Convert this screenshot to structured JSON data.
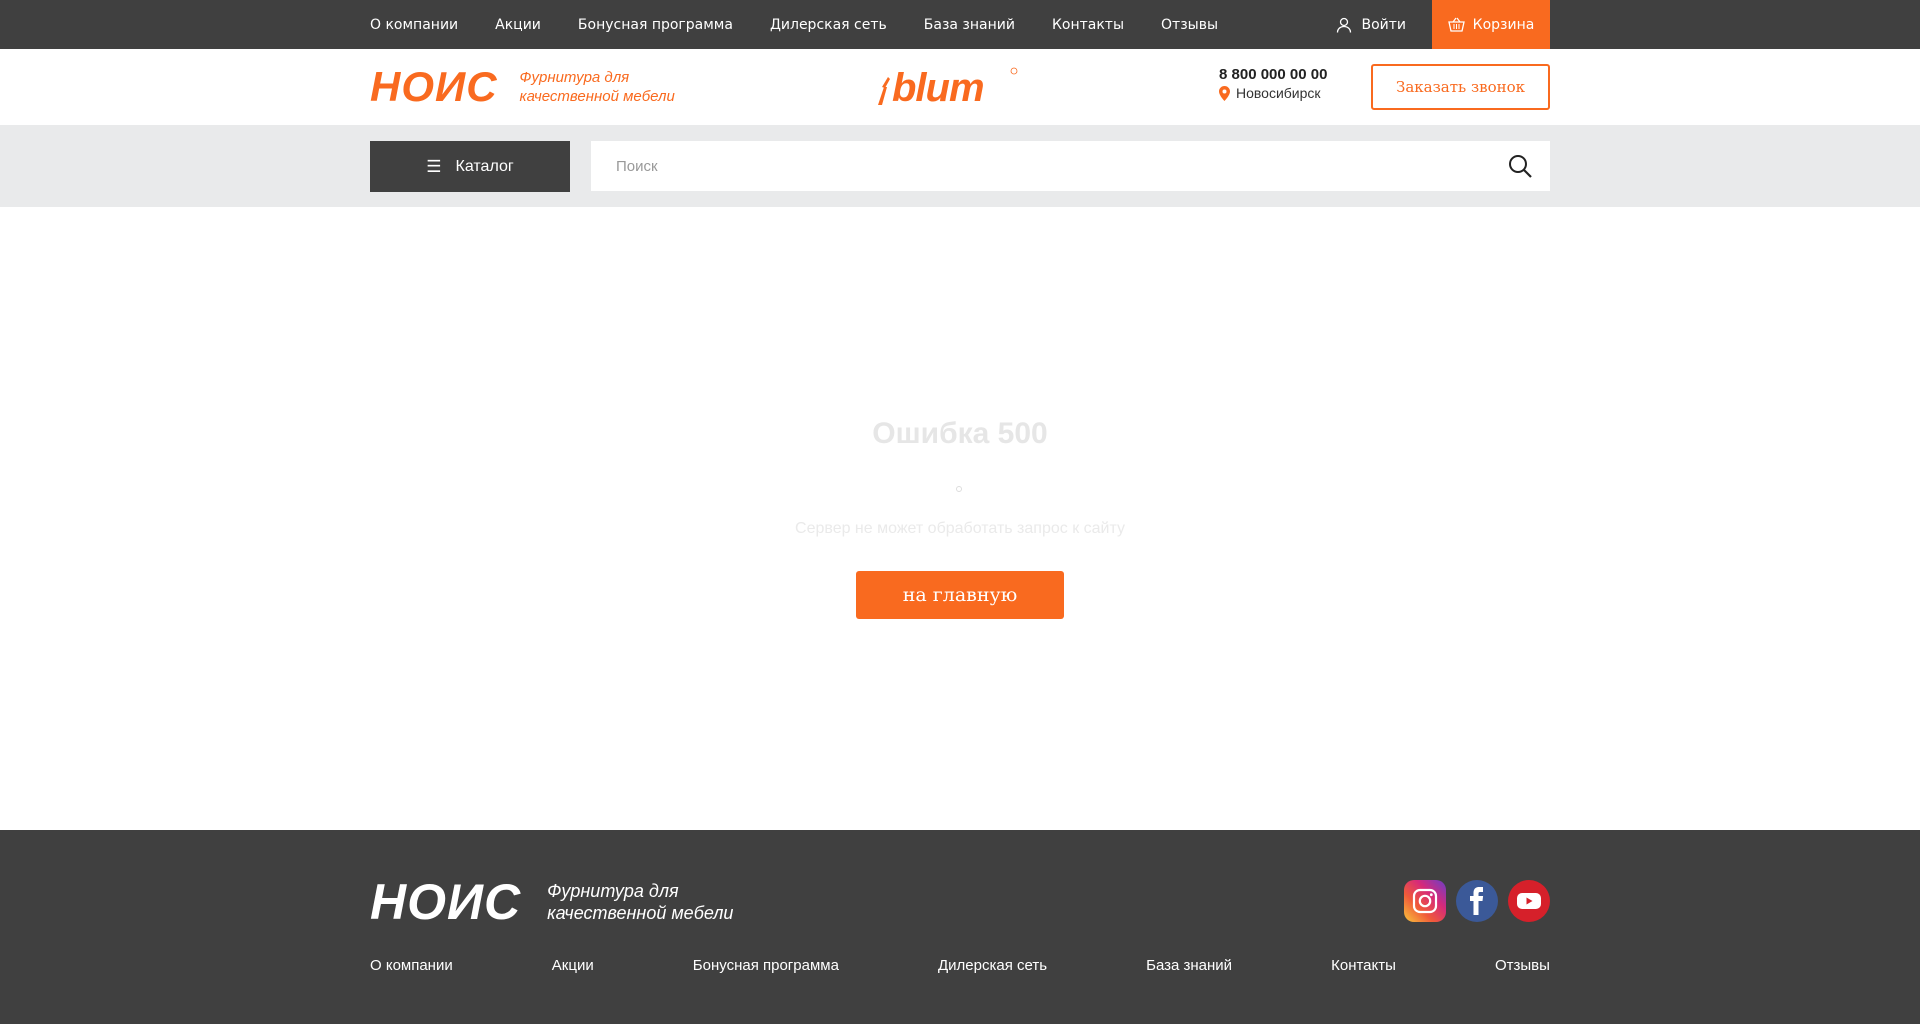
{
  "topnav": {
    "items": [
      "О компании",
      "Акции",
      "Бонусная программа",
      "Дилерская сеть",
      "База знаний",
      "Контакты",
      "Отзывы"
    ],
    "login": "Войти",
    "cart": "Корзина"
  },
  "header": {
    "logo_word": "НОИС",
    "logo_tagline_1": "Фурнитура для",
    "logo_tagline_2": "качественной мебели",
    "brand": "blum",
    "phone": "8 800 000 00 00",
    "city": "Новосибирск",
    "callback": "Заказать звонок"
  },
  "search": {
    "catalog": "Каталог",
    "placeholder": "Поиск"
  },
  "error": {
    "title": "Ошибка 500",
    "text": "Сервер не может обработать запрос к сайту",
    "home": "на главную"
  },
  "footer": {
    "logo_word": "НОИС",
    "logo_tagline_1": "Фурнитура для",
    "logo_tagline_2": "качественной мебели",
    "social": [
      "instagram-icon",
      "facebook-icon",
      "youtube-icon"
    ],
    "nav": [
      "О компании",
      "Акции",
      "Бонусная программа",
      "Дилерская сеть",
      "База знаний",
      "Контакты",
      "Отзывы"
    ]
  },
  "colors": {
    "accent": "#f96a1f",
    "dark": "#404040",
    "band": "#e9eaeb"
  }
}
